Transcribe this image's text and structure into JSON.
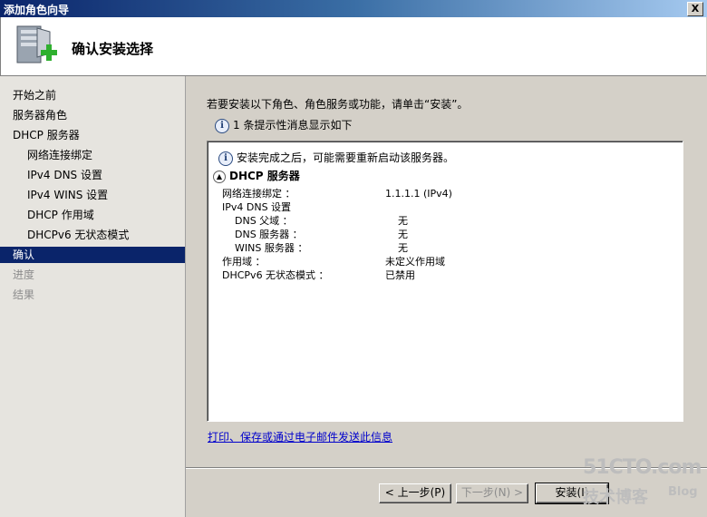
{
  "window": {
    "title": "添加角色向导",
    "close_label": "X"
  },
  "header": {
    "title": "确认安装选择"
  },
  "sidebar": {
    "items": [
      {
        "label": "开始之前"
      },
      {
        "label": "服务器角色"
      },
      {
        "label": "DHCP 服务器"
      },
      {
        "label": "网络连接绑定"
      },
      {
        "label": "IPv4 DNS 设置"
      },
      {
        "label": "IPv4 WINS 设置"
      },
      {
        "label": "DHCP 作用域"
      },
      {
        "label": "DHCPv6 无状态模式"
      },
      {
        "label": "确认"
      },
      {
        "label": "进度"
      },
      {
        "label": "结果"
      }
    ]
  },
  "main": {
    "intro": "若要安装以下角色、角色服务或功能，请单击“安装”。",
    "message_count": "1 条提示性消息显示如下",
    "panel": {
      "note": "安装完成之后，可能需要重新启动该服务器。",
      "section_title": "DHCP 服务器",
      "rows": [
        {
          "label": "网络连接绑定 ：",
          "value": "1.1.1.1 (IPv4)"
        },
        {
          "label": "IPv4 DNS 设置",
          "value": ""
        },
        {
          "label": "DNS 父域 ：",
          "value": "无"
        },
        {
          "label": "DNS 服务器 ：",
          "value": "无"
        },
        {
          "label": "WINS 服务器 ：",
          "value": "无"
        },
        {
          "label": "作用域 ：",
          "value": "未定义作用域"
        },
        {
          "label": "DHCPv6 无状态模式 ：",
          "value": "已禁用"
        }
      ]
    },
    "link": "打印、保存或通过电子邮件发送此信息"
  },
  "buttons": {
    "prev": "< 上一步(P)",
    "next": "下一步(N) >",
    "install": "安装(I)"
  },
  "watermark": {
    "line1": "51CTO.com",
    "line2": "技术博客",
    "line3": "Blog"
  }
}
